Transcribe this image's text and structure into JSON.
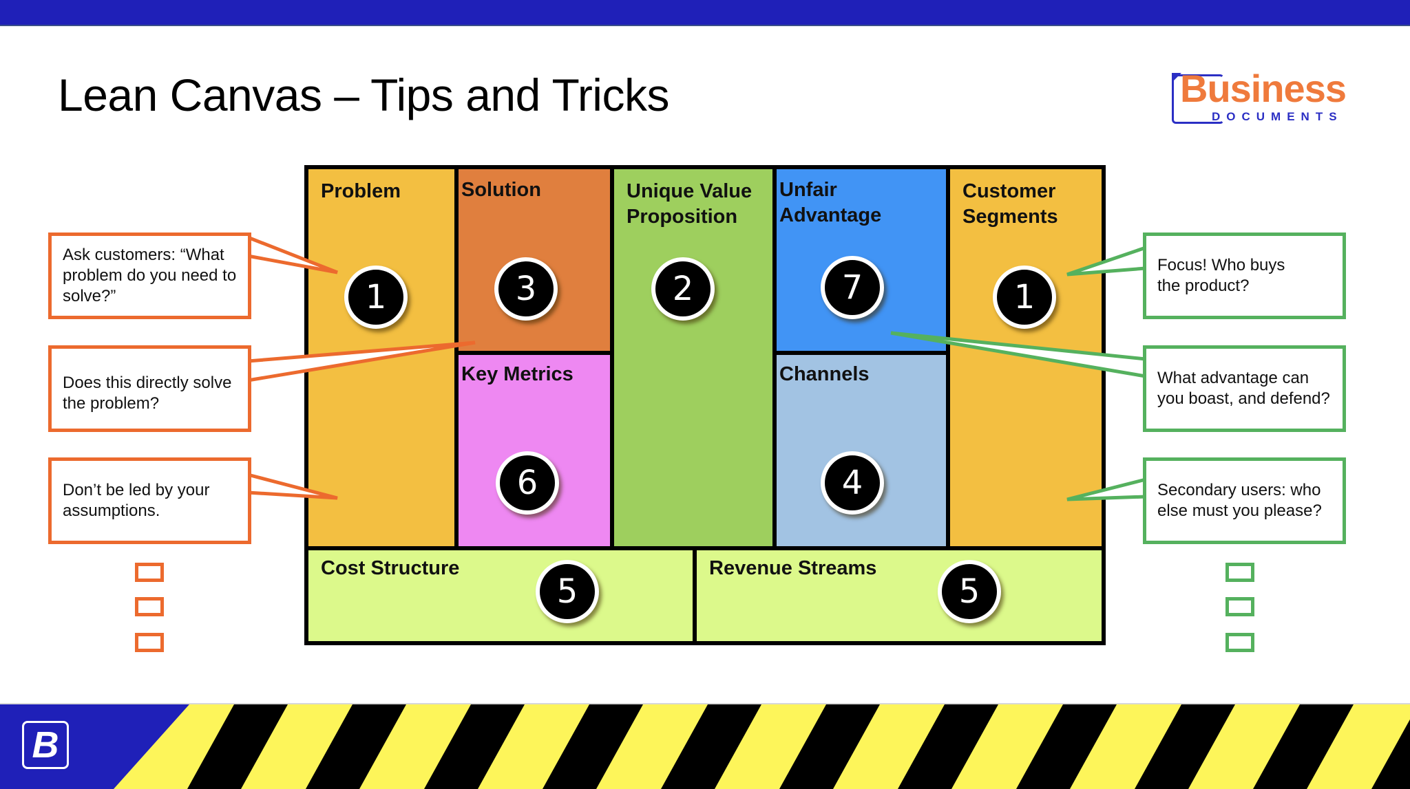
{
  "slide": {
    "title": "Lean Canvas – Tips and Tricks"
  },
  "logo": {
    "word": "Business",
    "sub": "DOCUMENTS",
    "footer_badge": "B"
  },
  "colors": {
    "top_bar": "#1f20b8",
    "orange_accent": "#ec6a2e",
    "green_accent": "#55b15e",
    "hazard_yellow": "#fdf55a",
    "hazard_black": "#000000"
  },
  "canvas": {
    "problem": {
      "title": "Problem",
      "step": "1",
      "color": "#f3bf41"
    },
    "solution": {
      "title": "Solution",
      "step": "3",
      "color": "#e07f3e"
    },
    "key_metrics": {
      "title": "Key Metrics",
      "step": "6",
      "color": "#ee88f2"
    },
    "uvp": {
      "title": "Unique Value Proposition",
      "step": "2",
      "color": "#9ecf5e"
    },
    "unfair_advantage": {
      "title": "Unfair Advantage",
      "step": "7",
      "color": "#4194f5"
    },
    "channels": {
      "title": "Channels",
      "step": "4",
      "color": "#a2c3e3"
    },
    "customer_segments": {
      "title": "Customer Segments",
      "step": "1",
      "color": "#f3bf41"
    },
    "cost_structure": {
      "title": "Cost Structure",
      "step": "5",
      "color": "#dcf98b"
    },
    "revenue_streams": {
      "title": "Revenue Streams",
      "step": "5",
      "color": "#dcf98b"
    }
  },
  "callouts": {
    "left": [
      "Ask customers: “What problem do you need to solve?”",
      "Does this directly solve the problem?",
      "Don’t be led by your assumptions."
    ],
    "right": [
      "Focus! Who buys the product?",
      "What advantage can you boast, and defend?",
      "Secondary users: who else must you please?"
    ]
  },
  "checkboxes": {
    "left_count": 3,
    "right_count": 3
  }
}
